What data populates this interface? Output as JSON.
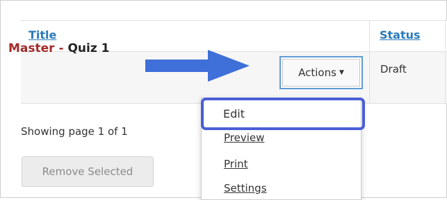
{
  "table": {
    "headers": {
      "title": "Title",
      "status": "Status"
    },
    "rows": [
      {
        "title_prefix": "Master -",
        "title_name": "Quiz 1",
        "actions_label": "Actions",
        "status": "Draft"
      }
    ]
  },
  "actions_menu": {
    "items": [
      "Edit",
      "Preview",
      "Print",
      "Settings"
    ],
    "highlighted": "Edit"
  },
  "pagination": {
    "text": "Showing page 1 of 1"
  },
  "buttons": {
    "remove_selected": "Remove Selected"
  },
  "colors": {
    "link": "#2a7ab9",
    "title_prefix": "#a52a2a",
    "callout": "#4a5fd6"
  },
  "icons": {
    "caret": "caret-down-icon",
    "arrow": "right-arrow-icon"
  }
}
